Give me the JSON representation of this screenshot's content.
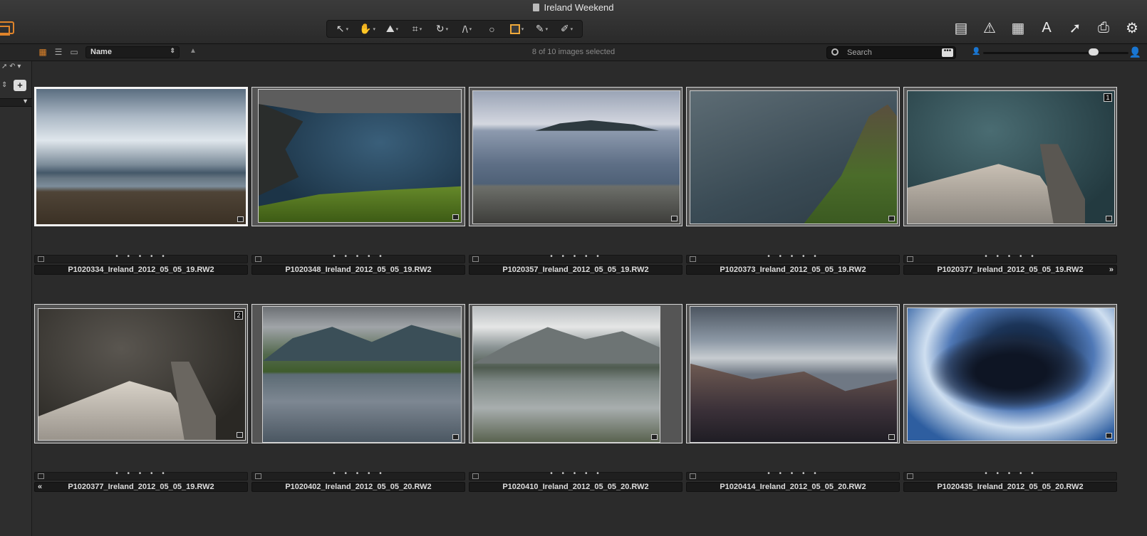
{
  "window": {
    "title": "Ireland Weekend"
  },
  "toolbar": {
    "tools": [
      {
        "name": "select-tool-icon",
        "glyph": "↖"
      },
      {
        "name": "pan-tool-icon",
        "glyph": "✋"
      },
      {
        "name": "straighten-tool-icon",
        "glyph": "⛰"
      },
      {
        "name": "crop-tool-icon",
        "glyph": "⌗"
      },
      {
        "name": "rotate-tool-icon",
        "glyph": "↻"
      },
      {
        "name": "keystone-tool-icon",
        "glyph": "/\\"
      },
      {
        "name": "spot-removal-tool-icon",
        "glyph": "○"
      },
      {
        "name": "mask-tool-icon",
        "glyph": ""
      },
      {
        "name": "color-picker-tool-icon",
        "glyph": "✎"
      },
      {
        "name": "brush-tool-icon",
        "glyph": "✐"
      }
    ],
    "right_tools": [
      {
        "name": "compare-icon",
        "glyph": "▤"
      },
      {
        "name": "exposure-warning-icon",
        "glyph": "⚠"
      },
      {
        "name": "grid-icon",
        "glyph": "▦"
      },
      {
        "name": "text-icon",
        "glyph": "A"
      },
      {
        "name": "apply-arrow-icon",
        "glyph": "➚"
      },
      {
        "name": "print-icon",
        "glyph": "⎙"
      },
      {
        "name": "settings-gear-icon",
        "glyph": "⚙"
      }
    ]
  },
  "browser_bar": {
    "sort_label": "Name",
    "selection_status": "8 of 10 images selected",
    "search_placeholder": "Search",
    "search_more": "•••",
    "thumbnail_size": 0.78
  },
  "images": [
    {
      "filename": "P1020334_Ireland_2012_05_05_19.RW2",
      "rating_dots": "• • • • •",
      "selected": true,
      "badge": "",
      "style": "i1"
    },
    {
      "filename": "P1020348_Ireland_2012_05_05_19.RW2",
      "rating_dots": "• • • • •",
      "selected": false,
      "badge": "",
      "style": "i2"
    },
    {
      "filename": "P1020357_Ireland_2012_05_05_19.RW2",
      "rating_dots": "• • • • •",
      "selected": false,
      "badge": "",
      "style": "i3"
    },
    {
      "filename": "P1020373_Ireland_2012_05_05_19.RW2",
      "rating_dots": "• • • • •",
      "selected": false,
      "badge": "",
      "style": "i4"
    },
    {
      "filename": "P1020377_Ireland_2012_05_05_19.RW2",
      "rating_dots": "• • • • •",
      "selected": false,
      "badge": "1",
      "style": "i5",
      "arrow_right": "»"
    },
    {
      "filename": "P1020377_Ireland_2012_05_05_19.RW2",
      "rating_dots": "• • • • •",
      "selected": false,
      "badge": "2",
      "style": "i6",
      "arrow_left": "«"
    },
    {
      "filename": "P1020402_Ireland_2012_05_05_20.RW2",
      "rating_dots": "• • • • •",
      "selected": false,
      "badge": "",
      "style": "i7"
    },
    {
      "filename": "P1020410_Ireland_2012_05_05_20.RW2",
      "rating_dots": "• • • • •",
      "selected": false,
      "badge": "",
      "style": "i8"
    },
    {
      "filename": "P1020414_Ireland_2012_05_05_20.RW2",
      "rating_dots": "• • • • •",
      "selected": false,
      "badge": "",
      "style": "i9"
    },
    {
      "filename": "P1020435_Ireland_2012_05_05_20.RW2",
      "rating_dots": "• • • • •",
      "selected": false,
      "badge": "",
      "style": "i10"
    }
  ],
  "colors": {
    "accent": "#e0842a",
    "background": "#2b2b2b",
    "selected_border": "#f4f4f4"
  }
}
